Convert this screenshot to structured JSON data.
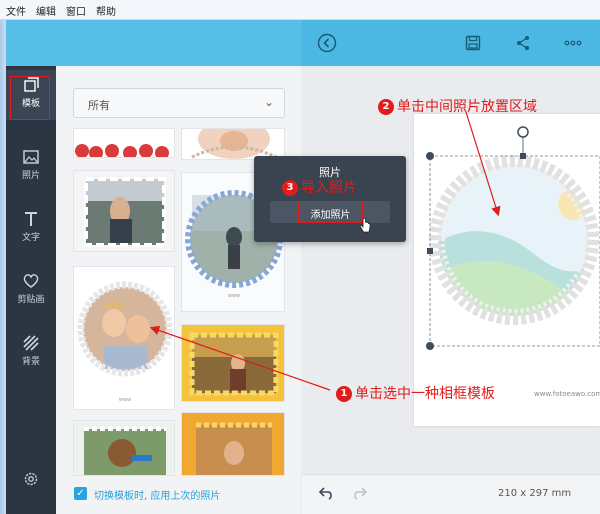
{
  "menubar": {
    "items": [
      "文件",
      "编辑",
      "窗口",
      "帮助"
    ]
  },
  "sidebar": {
    "items": [
      {
        "label": "模板",
        "icon": "template-icon"
      },
      {
        "label": "照片",
        "icon": "photo-icon"
      },
      {
        "label": "文字",
        "icon": "text-icon"
      },
      {
        "label": "剪贴画",
        "icon": "clipart-icon"
      },
      {
        "label": "背景",
        "icon": "background-icon"
      }
    ],
    "settings_icon": "gear-icon"
  },
  "panel": {
    "filter_value": "所有",
    "apply_last_photo_label": "切换模板时, 应用上次的照片"
  },
  "popup": {
    "title": "照片",
    "add_photo_label": "添加照片"
  },
  "bottombar": {
    "page_size": "210 x 297 mm"
  },
  "canvas": {
    "watermark": "www.fotoeawo.com"
  },
  "annotations": {
    "step1": {
      "num": "1",
      "text": "单击选中一种相框模板"
    },
    "step2": {
      "num": "2",
      "text": "单击中间照片放置区域"
    },
    "step3": {
      "num": "3",
      "text": "导入照片"
    }
  },
  "colors": {
    "accent": "#4bb8e3",
    "sidebar": "#2c3542",
    "annotation": "#e21b1b"
  }
}
